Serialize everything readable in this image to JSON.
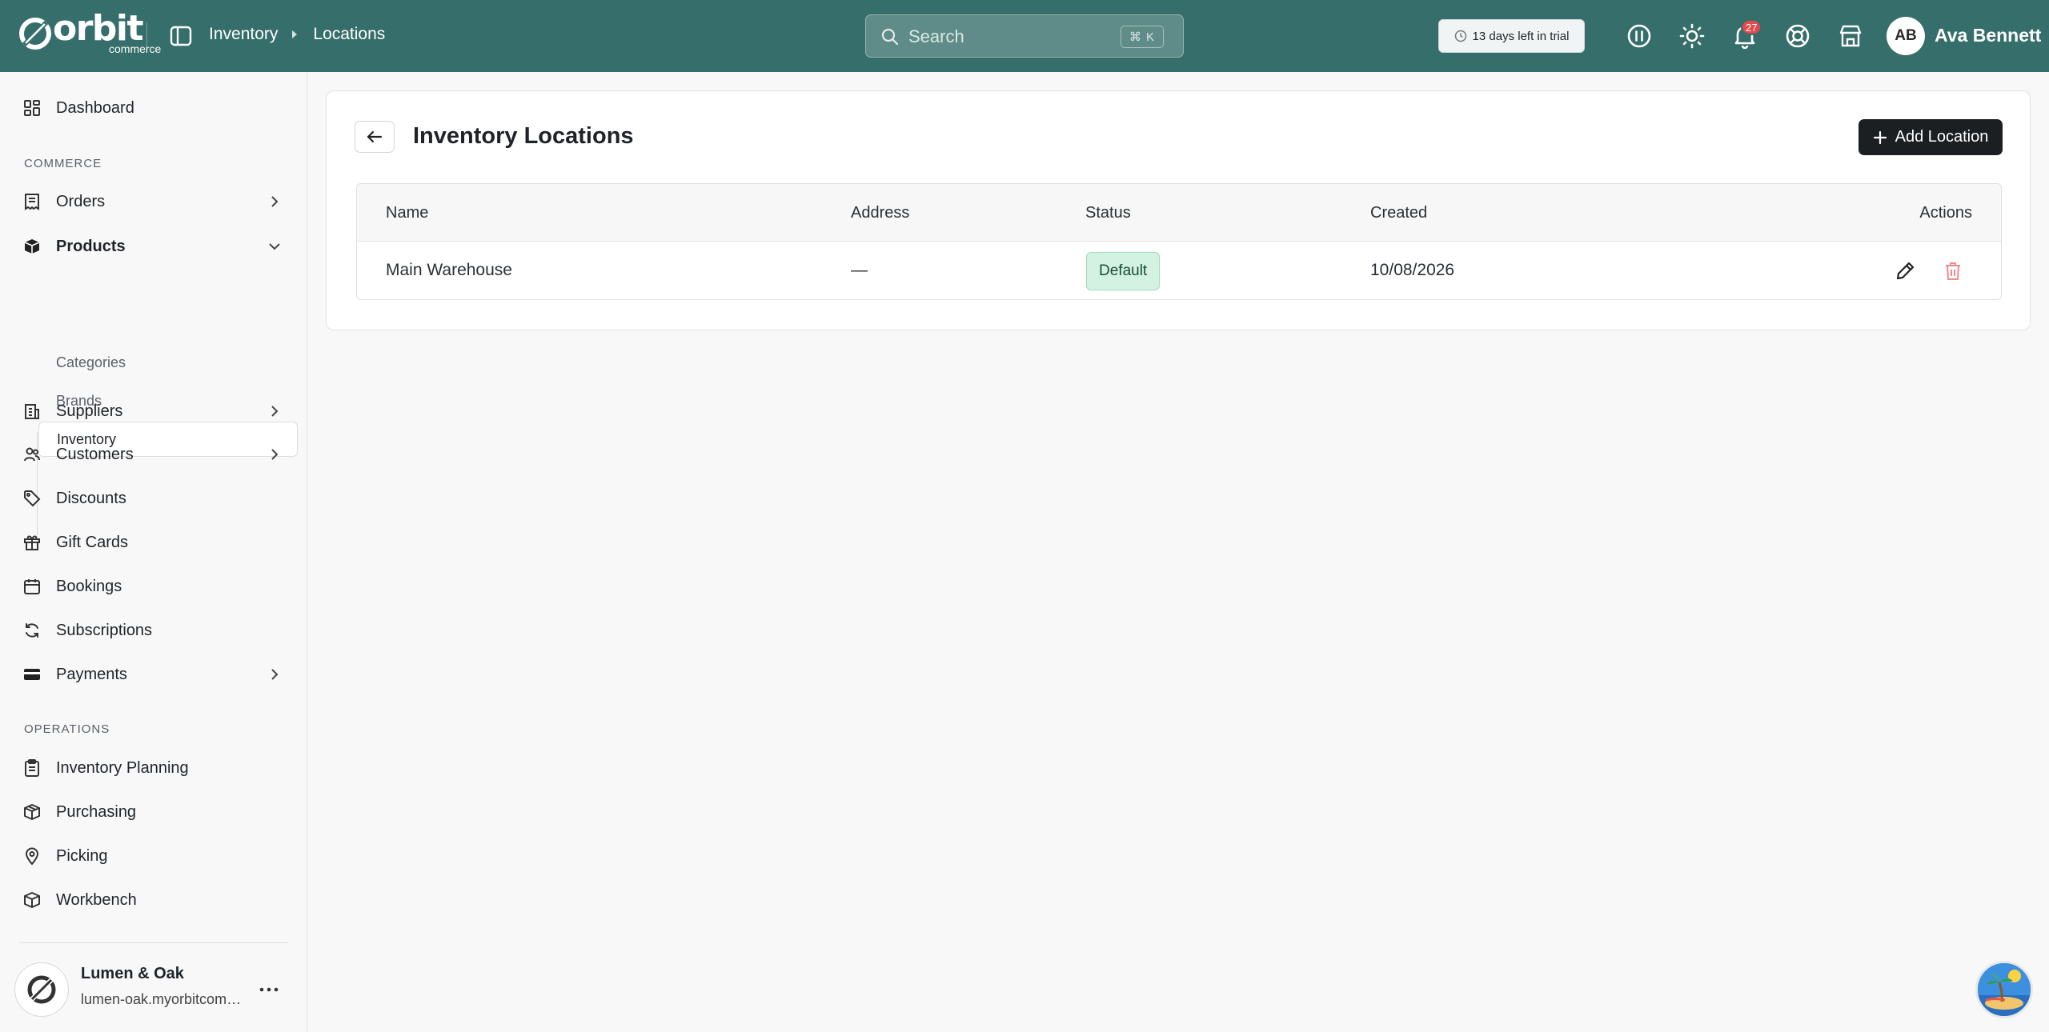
{
  "brand": {
    "name": "orbit",
    "sub": "commerce",
    "color": "#356e6a"
  },
  "breadcrumb": {
    "parent": "Inventory",
    "current": "Locations"
  },
  "search": {
    "placeholder": "Search",
    "shortcut": "⌘ K"
  },
  "trial": {
    "label": "13 days left in trial"
  },
  "notifications": {
    "count": "27"
  },
  "user": {
    "initials": "AB",
    "name": "Ava Bennett"
  },
  "sidebar": {
    "dashboard": "Dashboard",
    "commerce_label": "COMMERCE",
    "orders": "Orders",
    "products": "Products",
    "products_sub": {
      "categories": "Categories",
      "brands": "Brands",
      "inventory": "Inventory"
    },
    "suppliers": "Suppliers",
    "customers": "Customers",
    "discounts": "Discounts",
    "gift_cards": "Gift Cards",
    "bookings": "Bookings",
    "subscriptions": "Subscriptions",
    "payments": "Payments",
    "operations_label": "OPERATIONS",
    "inventory_planning": "Inventory Planning",
    "purchasing": "Purchasing",
    "picking": "Picking",
    "workbench": "Workbench"
  },
  "store": {
    "name": "Lumen & Oak",
    "url": "lumen-oak.myorbitcommerce.com"
  },
  "page": {
    "title": "Inventory Locations",
    "add_label": "Add Location"
  },
  "table": {
    "headers": {
      "name": "Name",
      "address": "Address",
      "status": "Status",
      "created": "Created",
      "actions": "Actions"
    },
    "rows": [
      {
        "name": "Main Warehouse",
        "address": "—",
        "status": "Default",
        "created": "10/08/2026"
      }
    ]
  }
}
